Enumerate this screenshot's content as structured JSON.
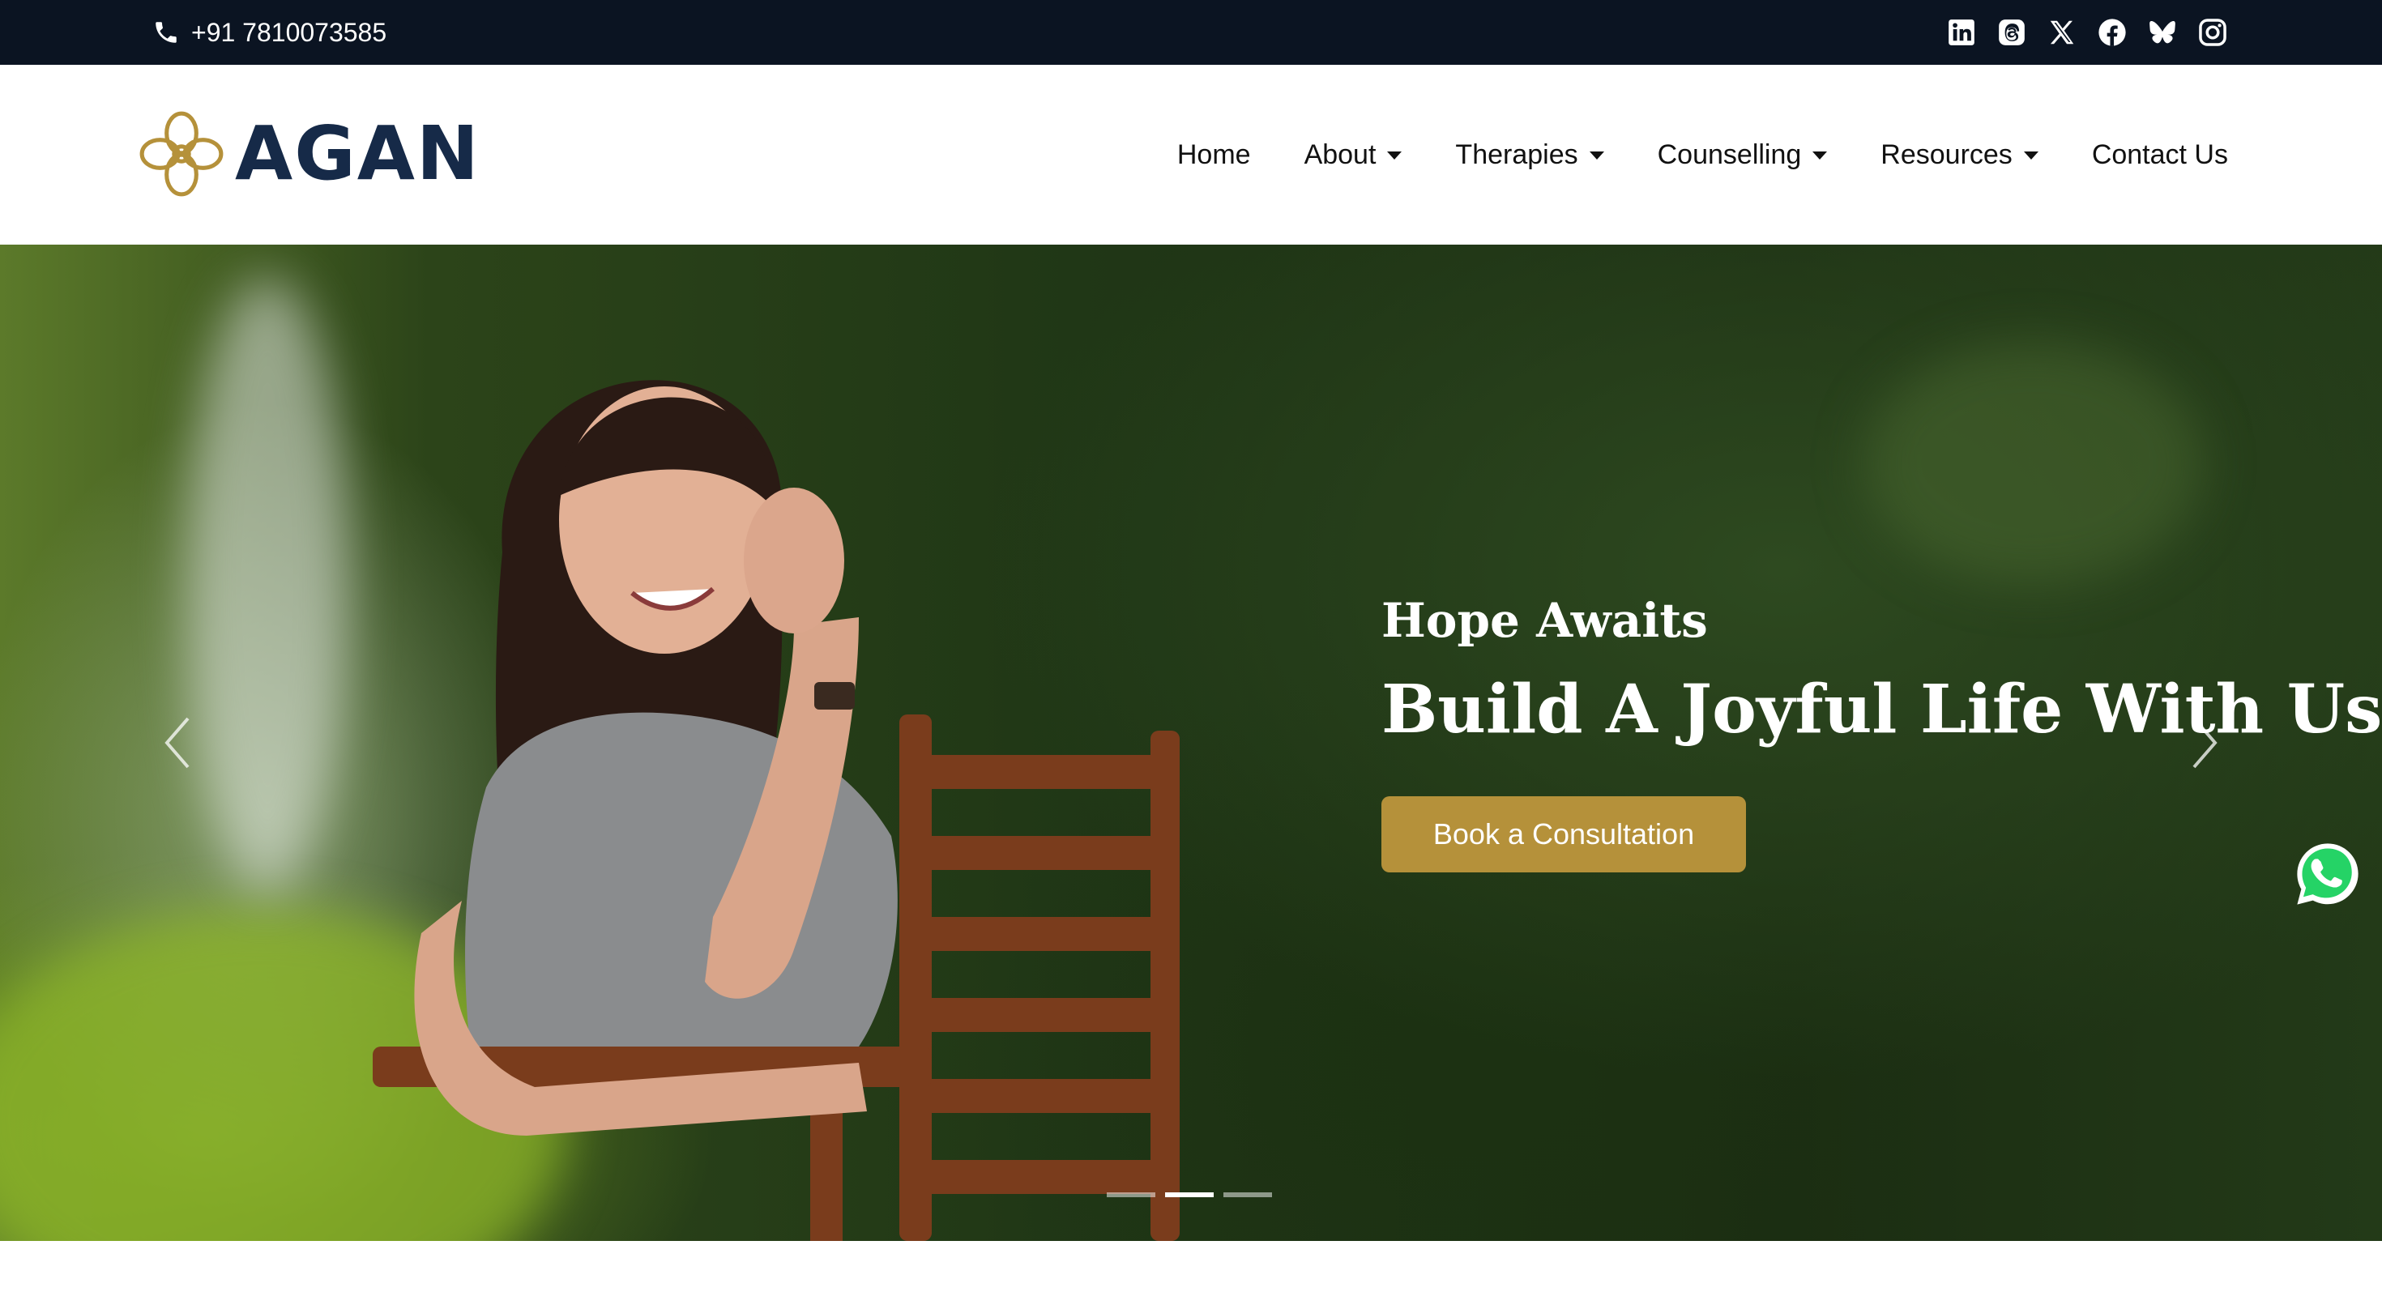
{
  "topbar": {
    "phone": "+91 7810073585",
    "socials": [
      {
        "name": "linkedin-icon"
      },
      {
        "name": "threads-icon"
      },
      {
        "name": "x-icon"
      },
      {
        "name": "facebook-icon"
      },
      {
        "name": "bluesky-icon"
      },
      {
        "name": "instagram-icon"
      }
    ]
  },
  "header": {
    "logo_text": "AGAN",
    "nav": [
      {
        "label": "Home",
        "dropdown": false
      },
      {
        "label": "About",
        "dropdown": true
      },
      {
        "label": "Therapies",
        "dropdown": true
      },
      {
        "label": "Counselling",
        "dropdown": true
      },
      {
        "label": "Resources",
        "dropdown": true
      },
      {
        "label": "Contact Us",
        "dropdown": false
      }
    ]
  },
  "hero": {
    "eyebrow": "Hope Awaits",
    "headline": "Build A Joyful Life With Us",
    "cta_label": "Book a Consultation",
    "slide_count": 3,
    "active_slide": 2
  },
  "colors": {
    "topbar_bg": "#0b1422",
    "brand_navy": "#162a48",
    "brand_gold": "#b5913a",
    "whatsapp_green": "#25d366"
  }
}
